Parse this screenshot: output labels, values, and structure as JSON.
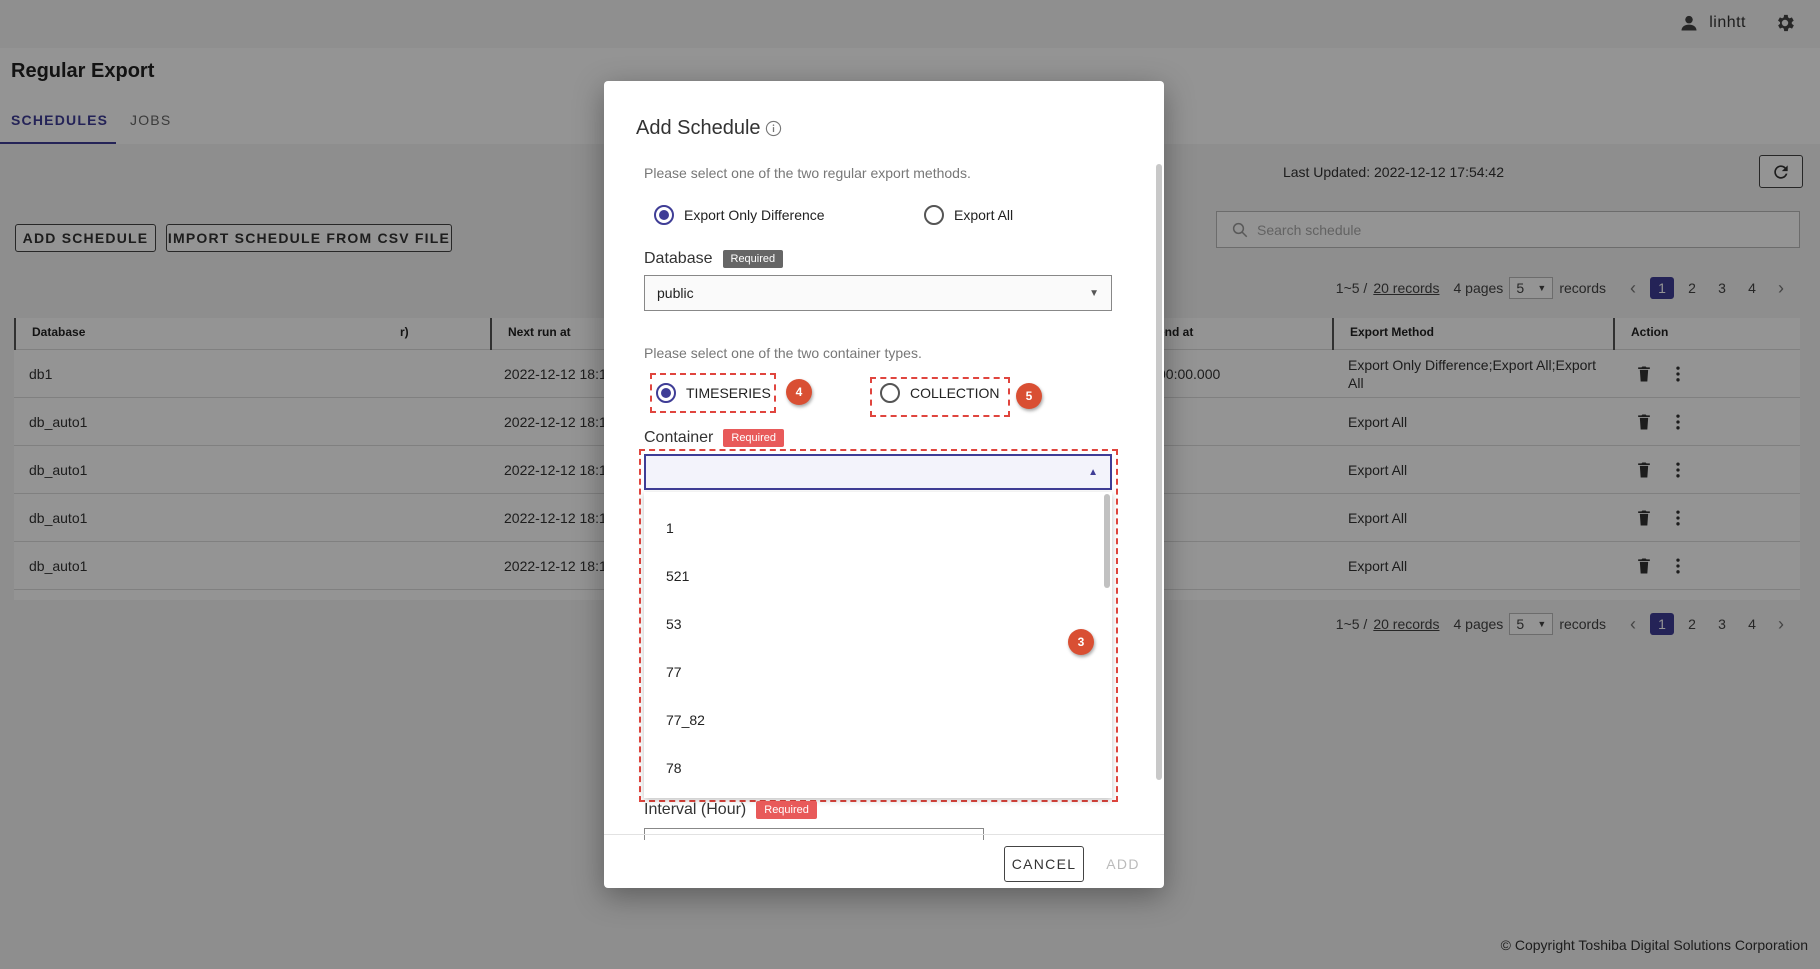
{
  "header": {
    "username": "linhtt"
  },
  "page": {
    "title": "Regular Export",
    "tabs": [
      {
        "label": "SCHEDULES"
      },
      {
        "label": "JOBS"
      }
    ],
    "last_updated": "Last Updated: 2022-12-12 17:54:42",
    "buttons": {
      "add_schedule": "ADD SCHEDULE",
      "import_csv": "IMPORT SCHEDULE FROM CSV FILE"
    },
    "search_placeholder": "Search schedule",
    "pager": {
      "range": "1~5 / ",
      "records_link": "20 records",
      "pages": "4 pages",
      "page_size": "5",
      "records_suffix": "records",
      "page_numbers": [
        "1",
        "2",
        "3",
        "4"
      ]
    },
    "table": {
      "columns": [
        "Database",
        "r)",
        "Next run at",
        "end at",
        "Export Method",
        "Action"
      ],
      "rows": [
        {
          "database": "db1",
          "next_run": "2022-12-12 18:1",
          "end": "00:00.000",
          "method": "Export Only Difference;Export All;Export All"
        },
        {
          "database": "db_auto1",
          "next_run": "2022-12-12 18:1",
          "end": "",
          "method": "Export All"
        },
        {
          "database": "db_auto1",
          "next_run": "2022-12-12 18:1",
          "end": "",
          "method": "Export All"
        },
        {
          "database": "db_auto1",
          "next_run": "2022-12-12 18:1",
          "end": "",
          "method": "Export All"
        },
        {
          "database": "db_auto1",
          "next_run": "2022-12-12 18:1",
          "end": "",
          "method": "Export All"
        }
      ]
    },
    "footer": "© Copyright Toshiba Digital Solutions Corporation"
  },
  "dialog": {
    "title": "Add Schedule",
    "export_hint": "Please select one of the two regular export methods.",
    "export_options": [
      {
        "label": "Export Only Difference",
        "checked": true
      },
      {
        "label": "Export All",
        "checked": false
      }
    ],
    "database_label": "Database",
    "required": "Required",
    "database_value": "public",
    "container_hint": "Please select one of the two container types.",
    "container_types": [
      {
        "label": "TIMESERIES",
        "checked": true
      },
      {
        "label": "COLLECTION",
        "checked": false
      }
    ],
    "container_label": "Container",
    "container_value": "",
    "container_options": [
      "1",
      "521",
      "53",
      "77",
      "77_82",
      "78"
    ],
    "interval_label": "Interval (Hour)",
    "markers": [
      "4",
      "5",
      "3"
    ],
    "cancel": "CANCEL",
    "add": "ADD"
  }
}
